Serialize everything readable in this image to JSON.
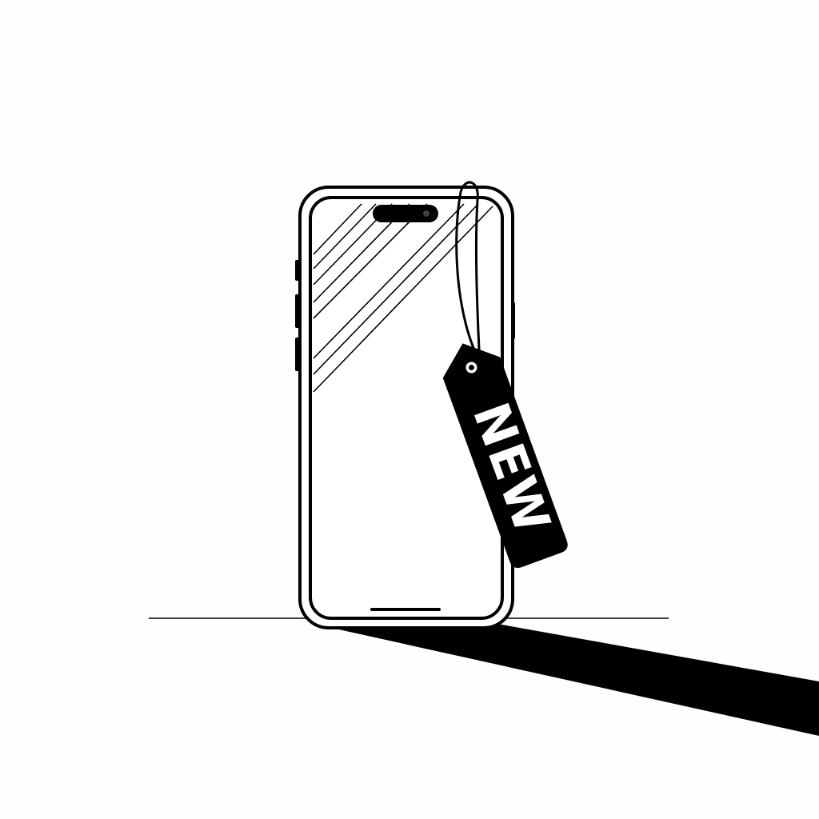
{
  "tag": {
    "label": "NEW"
  },
  "colors": {
    "background": "#fefefe",
    "ink": "#000000",
    "paper": "#ffffff"
  },
  "icons": {
    "device": "smartphone-icon",
    "tag": "price-tag-icon"
  }
}
